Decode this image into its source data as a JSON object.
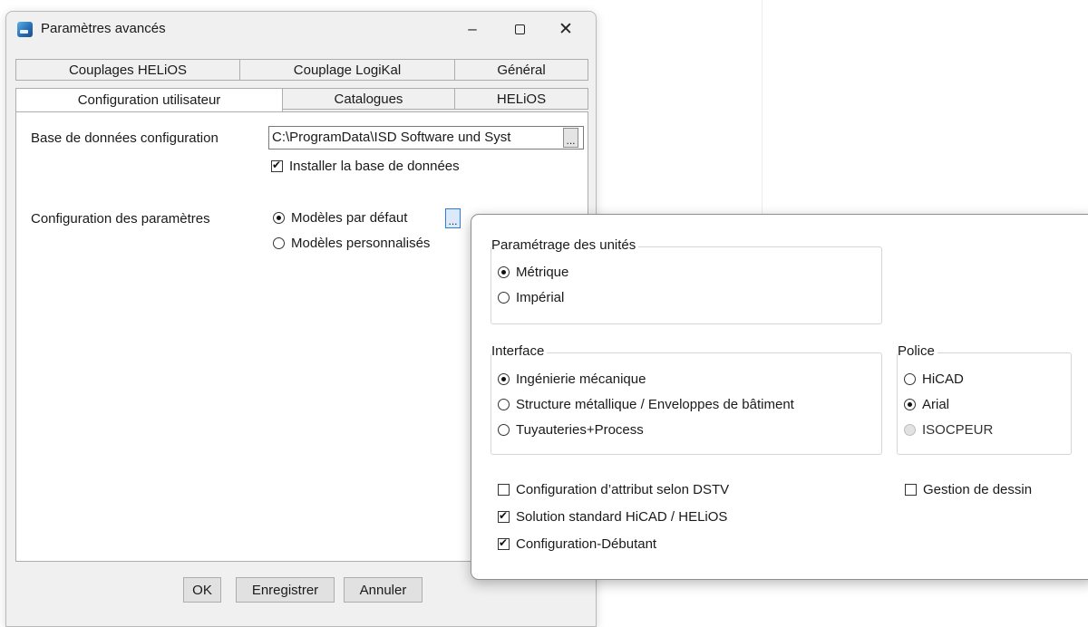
{
  "window": {
    "title": "Paramètres avancés",
    "minimize": "–",
    "close": "✕"
  },
  "tabs": {
    "row1": [
      "Couplages HELiOS",
      "Couplage LogiKal",
      "Général"
    ],
    "row2": [
      "Configuration utilisateur",
      "Catalogues",
      "HELiOS"
    ],
    "active": "Configuration utilisateur"
  },
  "config": {
    "db_label": "Base de données configuration",
    "db_path": "C:\\ProgramData\\ISD Software und Syst",
    "install_db_label": "Installer la base de données",
    "install_db_checked": true,
    "params_label": "Configuration des paramètres",
    "default_models_label": "Modèles par défaut",
    "custom_models_label": "Modèles personnalisés",
    "selected": "default",
    "browse_label": "..."
  },
  "footer": {
    "ok": "OK",
    "save": "Enregistrer",
    "cancel": "Annuler"
  },
  "popup": {
    "units": {
      "title": "Paramétrage des unités",
      "options": [
        "Métrique",
        "Impérial"
      ],
      "selected": "Métrique"
    },
    "interface": {
      "title": "Interface",
      "options": [
        "Ingénierie mécanique",
        "Structure métallique / Enveloppes de bâtiment",
        "Tuyauteries+Process"
      ],
      "selected": "Ingénierie mécanique"
    },
    "font": {
      "title": "Police",
      "options": [
        "HiCAD",
        "Arial",
        "ISOCPEUR"
      ],
      "selected": "Arial",
      "disabled": "ISOCPEUR"
    },
    "checks": {
      "dstv": {
        "label": "Configuration d’attribut selon DSTV",
        "checked": false
      },
      "drawing_mgmt": {
        "label": "Gestion de dessin",
        "checked": false
      },
      "standard": {
        "label": "Solution standard HiCAD / HELiOS",
        "checked": true
      },
      "beginner": {
        "label": "Configuration-Débutant",
        "checked": true
      }
    }
  },
  "colors": {
    "dialog_bg": "#f0f0f0",
    "panel_bg": "#ffffff",
    "focus_blue": "#2f7bd9"
  }
}
